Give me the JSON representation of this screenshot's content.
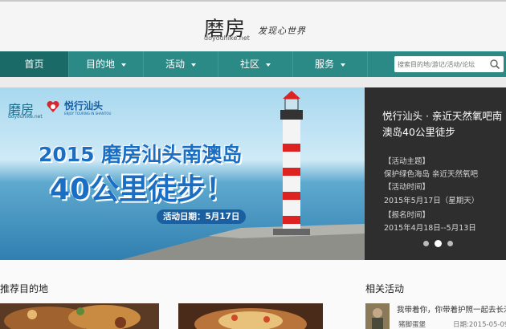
{
  "header": {
    "logo_text": "磨房",
    "logo_domain": "doyouhike.net",
    "slogan": "发现心世界"
  },
  "nav": {
    "items": [
      {
        "label": "首页",
        "active": true,
        "dropdown": false
      },
      {
        "label": "目的地",
        "active": false,
        "dropdown": true
      },
      {
        "label": "活动",
        "active": false,
        "dropdown": true
      },
      {
        "label": "社区",
        "active": false,
        "dropdown": true
      },
      {
        "label": "服务",
        "active": false,
        "dropdown": true
      }
    ],
    "search_placeholder": "搜索目的地/游记/活动/论坛"
  },
  "banner": {
    "brand_text": "磨房",
    "brand_domain": "doyouhike.net",
    "partner_name": "悦行汕头",
    "partner_sub": "ENJOY TOURING IN SHANTOU",
    "headline": "2015 磨房汕头南澳岛",
    "headline2": "40公里徒步！",
    "date_label": "活动日期：5月17日"
  },
  "info_panel": {
    "title": "悦行汕头 · 亲近天然氧吧南澳岛40公里徒步",
    "lines": [
      "【活动主题】",
      "保护绿色海岛 亲近天然氧吧",
      "【活动时间】",
      "2015年5月17日（星期天）",
      "【报名时间】",
      "2015年4月18日--5月13日"
    ],
    "dots": 3,
    "active_dot": 1
  },
  "sections": {
    "recommended_title": "推荐目的地",
    "related_title": "相关活动",
    "related_item_text": "我带着你，你带着护照一起去长沙",
    "related_author": "猪脚蛋堡",
    "related_date": "日期:2015-05-09"
  },
  "colors": {
    "nav_bg": "#2c8a86",
    "nav_active": "#1a6b68",
    "info_bg": "#2e2e2e",
    "headline_blue": "#1a6fc4"
  }
}
